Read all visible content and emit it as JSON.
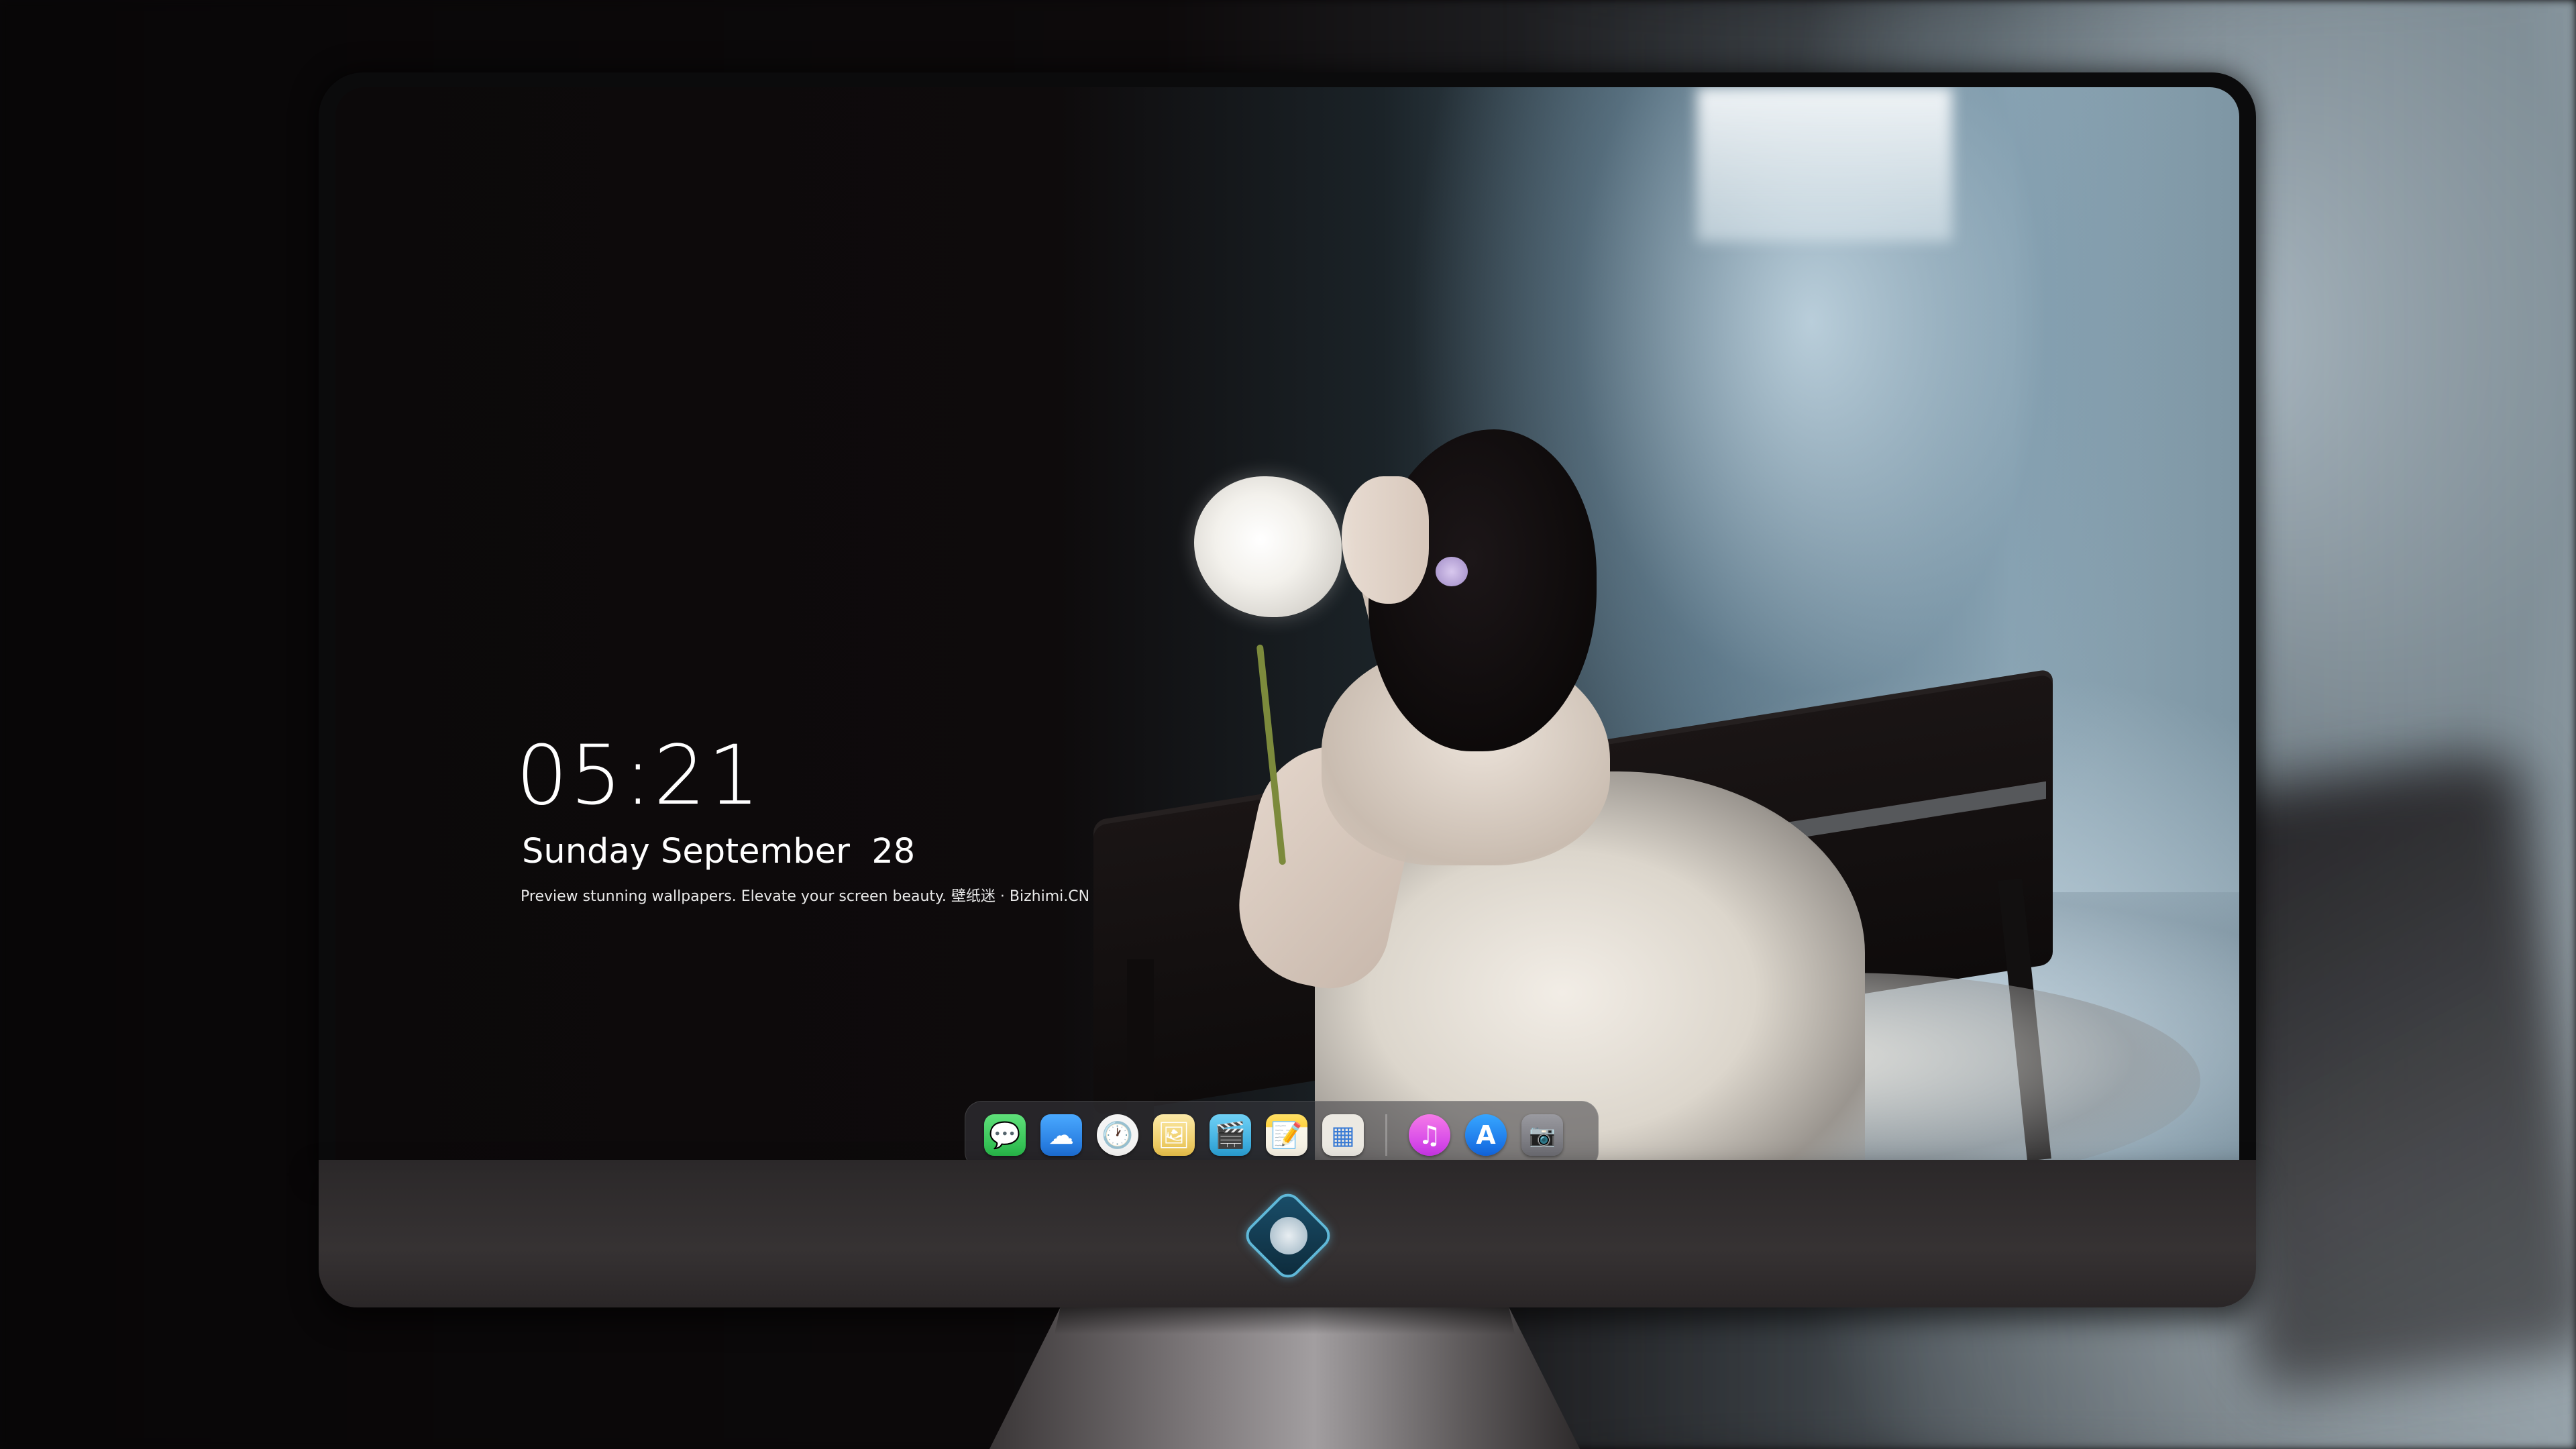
{
  "lockscreen": {
    "time": "05:21",
    "date": "Sunday September  28",
    "tagline": "Preview stunning wallpapers. Elevate your screen beauty. 壁纸迷 · Bizhimi.CN"
  },
  "dock": {
    "apps": [
      {
        "name": "messages-icon",
        "glyph": "💬",
        "color": "#34c759"
      },
      {
        "name": "weather-icon",
        "glyph": "☁",
        "color": "#2f8ff0"
      },
      {
        "name": "clock-icon",
        "glyph": "🕐",
        "color": "#f2f2f2"
      },
      {
        "name": "preview-icon",
        "glyph": "🖼",
        "color": "#f5d76e"
      },
      {
        "name": "clips-icon",
        "glyph": "🎬",
        "color": "#48b6e6"
      },
      {
        "name": "notes-icon",
        "glyph": "📝",
        "color": "#ffd23f"
      },
      {
        "name": "photo-booth-icon",
        "glyph": "▦",
        "color": "#e9e6e0"
      },
      {
        "name": "music-icon",
        "glyph": "♫",
        "color": "#e94adb"
      },
      {
        "name": "app-store-icon",
        "glyph": "A",
        "color": "#1b86f2"
      },
      {
        "name": "camera-icon",
        "glyph": "📷",
        "color": "#8a8a8e"
      }
    ]
  },
  "brand": {
    "logo": "dragon-mascot-logo",
    "accent": "#5fb8d8"
  }
}
